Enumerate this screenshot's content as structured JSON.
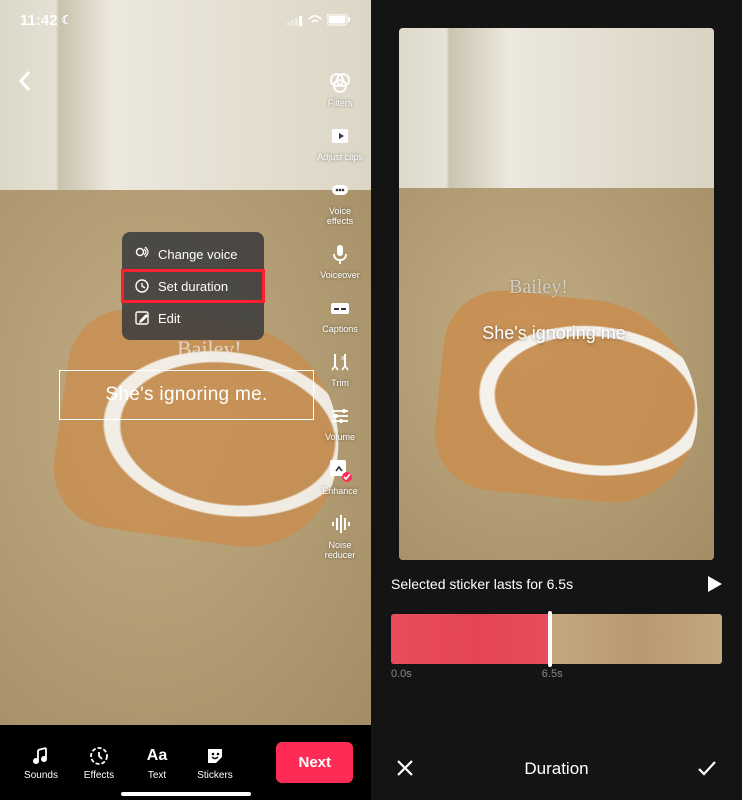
{
  "status": {
    "time": "11:42",
    "moon": "☾"
  },
  "left": {
    "bailey": "Bailey!",
    "caption": "She's ignoring me.",
    "toolbar": [
      {
        "name": "filters",
        "label": "Filters"
      },
      {
        "name": "adjust-clips",
        "label": "Adjust clips"
      },
      {
        "name": "voice-effects",
        "label": "Voice effects"
      },
      {
        "name": "voiceover",
        "label": "Voiceover"
      },
      {
        "name": "captions",
        "label": "Captions"
      },
      {
        "name": "trim",
        "label": "Trim"
      },
      {
        "name": "volume",
        "label": "Volume"
      },
      {
        "name": "enhance",
        "label": "Enhance"
      },
      {
        "name": "noise-reducer",
        "label": "Noise reducer"
      }
    ],
    "popup": [
      {
        "name": "change-voice",
        "label": "Change voice"
      },
      {
        "name": "set-duration",
        "label": "Set duration",
        "highlighted": true
      },
      {
        "name": "edit",
        "label": "Edit"
      }
    ],
    "bottom": [
      {
        "name": "sounds",
        "label": "Sounds"
      },
      {
        "name": "effects",
        "label": "Effects"
      },
      {
        "name": "text",
        "label": "Text"
      },
      {
        "name": "stickers",
        "label": "Stickers"
      }
    ],
    "next": "Next"
  },
  "right": {
    "bailey": "Bailey!",
    "caption": "She's ignoring me.",
    "info": "Selected sticker lasts for 6.5s",
    "ticks": {
      "start": "0.0s",
      "mid": "6.5s"
    },
    "title": "Duration"
  }
}
